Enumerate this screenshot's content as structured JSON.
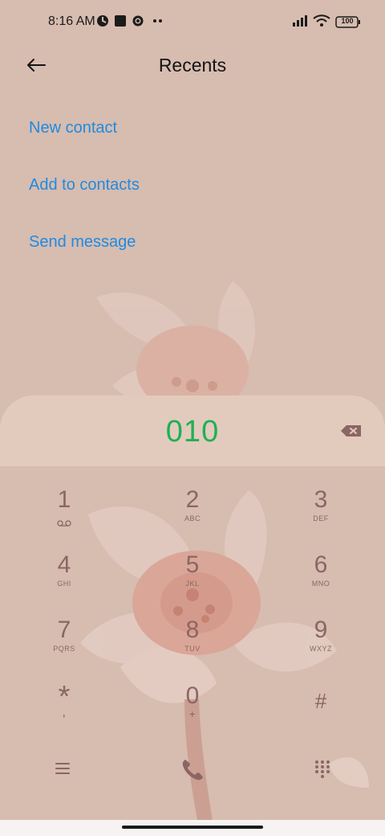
{
  "status_bar": {
    "time": "8:16 AM",
    "battery": "100",
    "icons": [
      "app-icon",
      "square-icon",
      "gear-icon",
      "more-dots-icon",
      "signal-icon",
      "wifi-icon",
      "battery-icon"
    ]
  },
  "header": {
    "title": "Recents",
    "back_icon": "back-arrow-icon"
  },
  "actions": [
    {
      "label": "New contact"
    },
    {
      "label": "Add to contacts"
    },
    {
      "label": "Send message"
    }
  ],
  "dialer": {
    "number": "010",
    "keys": [
      {
        "digit": "1",
        "sub": ""
      },
      {
        "digit": "2",
        "sub": "ABC"
      },
      {
        "digit": "3",
        "sub": "DEF"
      },
      {
        "digit": "4",
        "sub": "GHI"
      },
      {
        "digit": "5",
        "sub": "JKL"
      },
      {
        "digit": "6",
        "sub": "MNO"
      },
      {
        "digit": "7",
        "sub": "PQRS"
      },
      {
        "digit": "8",
        "sub": "TUV"
      },
      {
        "digit": "9",
        "sub": "WXYZ"
      },
      {
        "digit": "*",
        "sub": ","
      },
      {
        "digit": "0",
        "sub": "+"
      },
      {
        "digit": "#",
        "sub": ""
      }
    ],
    "bottom_icons": [
      "menu-icon",
      "phone-icon",
      "keypad-icon"
    ]
  },
  "colors": {
    "background": "#d7bcb0",
    "entry_panel": "#e2cbbd",
    "accent_link": "#1f8be0",
    "number_green": "#1fb055",
    "key_text": "#8b6664"
  }
}
